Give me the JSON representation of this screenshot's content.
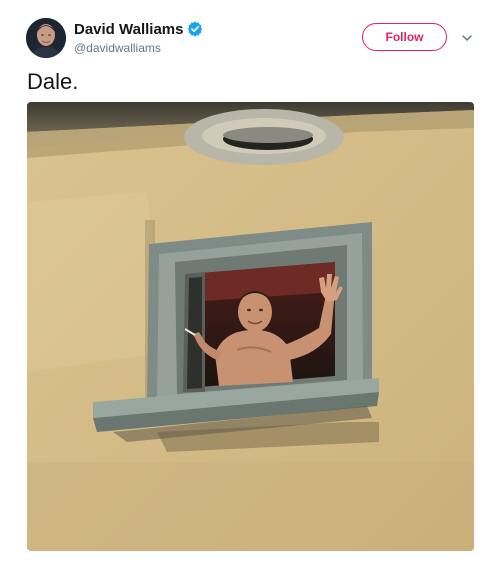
{
  "user": {
    "display_name": "David Walliams",
    "handle": "@davidwalliams",
    "verified": true
  },
  "icons": {
    "verified": "verified-badge-icon",
    "more": "chevron-down-icon"
  },
  "actions": {
    "follow_label": "Follow"
  },
  "tweet": {
    "text": "Dale."
  },
  "colors": {
    "accent": "#e0245e",
    "verified": "#1da1f2",
    "text_primary": "#14171a",
    "text_secondary": "#657786"
  }
}
